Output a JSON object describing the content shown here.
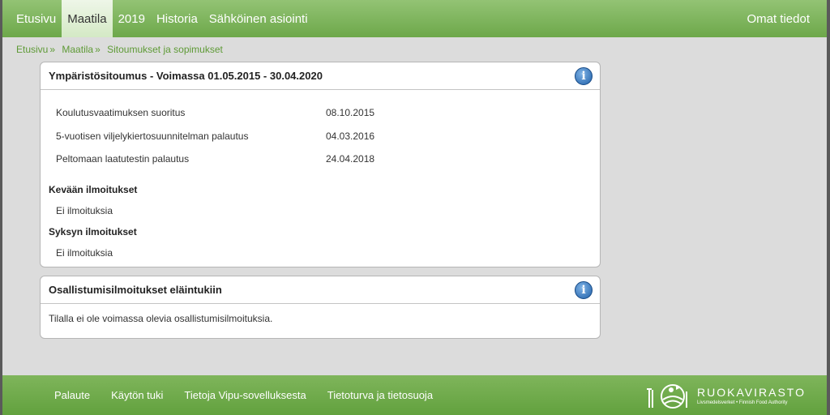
{
  "nav": {
    "items": [
      "Etusivu",
      "Maatila",
      "2019",
      "Historia",
      "Sähköinen asiointi"
    ],
    "active": "Maatila",
    "right": "Omat tiedot"
  },
  "breadcrumb": [
    "Etusivu",
    "Maatila",
    "Sitoumukset ja sopimukset"
  ],
  "breadcrumb_sep": "»",
  "panel1": {
    "title": "Ympäristösitoumus - Voimassa 01.05.2015 - 30.04.2020",
    "rows": [
      {
        "label": "Koulutusvaatimuksen suoritus",
        "value": "08.10.2015"
      },
      {
        "label": "5-vuotisen viljelykiertosuunnitelman palautus",
        "value": "04.03.2016"
      },
      {
        "label": "Peltomaan laatutestin palautus",
        "value": "24.04.2018"
      }
    ],
    "spring_title": "Kevään ilmoitukset",
    "spring_text": "Ei ilmoituksia",
    "autumn_title": "Syksyn ilmoitukset",
    "autumn_text": "Ei ilmoituksia"
  },
  "panel2": {
    "title": "Osallistumisilmoitukset eläintukiin",
    "text": "Tilalla ei ole voimassa olevia osallistumisilmoituksia."
  },
  "info_icon_glyph": "i",
  "footer": {
    "links": [
      "Palaute",
      "Käytön tuki",
      "Tietoja Vipu-sovelluksesta",
      "Tietoturva ja tietosuoja"
    ],
    "logo_name": "RUOKAVIRASTO",
    "logo_sub": "Livsmedelsverket • Finnish Food Authority"
  }
}
